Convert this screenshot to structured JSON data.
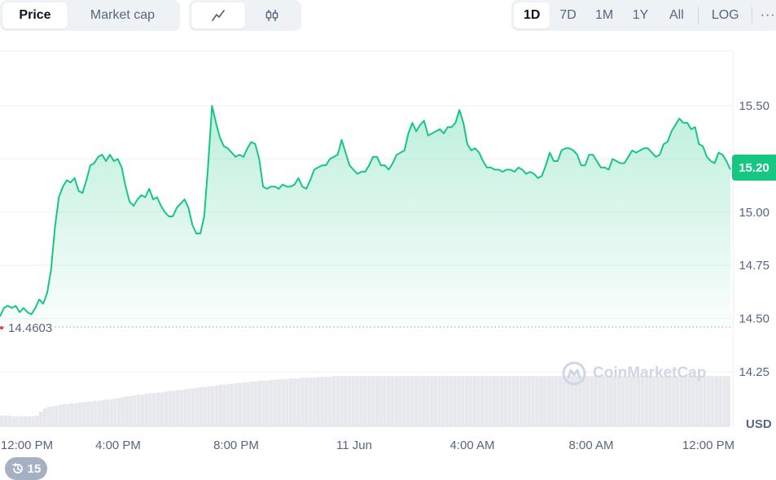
{
  "toolbar": {
    "type_options": [
      "Price",
      "Market cap"
    ],
    "type_selected": "Price",
    "mode_icons": [
      "line-chart-icon",
      "candlestick-icon"
    ],
    "range_options": [
      "1D",
      "7D",
      "1M",
      "1Y",
      "All"
    ],
    "range_selected": "1D",
    "log_label": "LOG",
    "more_label": "···"
  },
  "badges": {
    "current_price": "15.20",
    "open_price": "14.4603",
    "currency": "USD",
    "watermark": "CoinMarketCap",
    "history_count": "15"
  },
  "colors": {
    "line": "#16c784",
    "badge": "#16c784",
    "volume": "#e6e8ec",
    "grid": "#eff2f5",
    "text_muted": "#58667e"
  },
  "chart_data": {
    "type": "area",
    "y_ticks": [
      "15.50",
      "15.00",
      "14.75",
      "14.50",
      "14.25"
    ],
    "x_ticks": [
      "12:00 PM",
      "4:00 PM",
      "8:00 PM",
      "11 Jun",
      "4:00 AM",
      "8:00 AM",
      "12:00 PM"
    ],
    "ylim": [
      14.25,
      15.75
    ],
    "baseline": 14.4603,
    "series": [
      {
        "values": [
          14.51,
          14.55,
          14.56,
          14.55,
          14.56,
          14.53,
          14.55,
          14.53,
          14.52,
          14.55,
          14.59,
          14.57,
          14.62,
          14.73,
          14.93,
          15.07,
          15.12,
          15.15,
          15.14,
          15.16,
          15.1,
          15.09,
          15.15,
          15.22,
          15.23,
          15.26,
          15.27,
          15.24,
          15.27,
          15.24,
          15.25,
          15.21,
          15.12,
          15.05,
          15.03,
          15.06,
          15.08,
          15.07,
          15.11,
          15.06,
          15.07,
          15.03,
          15.0,
          14.98,
          14.98,
          15.02,
          15.04,
          15.06,
          15.02,
          14.94,
          14.9,
          14.9,
          14.98,
          15.22,
          15.5,
          15.42,
          15.35,
          15.31,
          15.3,
          15.28,
          15.26,
          15.27,
          15.26,
          15.3,
          15.33,
          15.32,
          15.25,
          15.12,
          15.11,
          15.12,
          15.12,
          15.11,
          15.13,
          15.12,
          15.12,
          15.13,
          15.16,
          15.12,
          15.11,
          15.15,
          15.2,
          15.21,
          15.22,
          15.22,
          15.25,
          15.26,
          15.27,
          15.34,
          15.28,
          15.22,
          15.2,
          15.18,
          15.19,
          15.19,
          15.22,
          15.26,
          15.26,
          15.22,
          15.22,
          15.2,
          15.23,
          15.27,
          15.28,
          15.29,
          15.37,
          15.42,
          15.38,
          15.41,
          15.43,
          15.36,
          15.37,
          15.38,
          15.39,
          15.37,
          15.4,
          15.4,
          15.42,
          15.48,
          15.42,
          15.32,
          15.29,
          15.3,
          15.28,
          15.24,
          15.21,
          15.21,
          15.2,
          15.2,
          15.19,
          15.2,
          15.2,
          15.19,
          15.21,
          15.2,
          15.18,
          15.19,
          15.18,
          15.16,
          15.17,
          15.22,
          15.28,
          15.24,
          15.24,
          15.29,
          15.3,
          15.3,
          15.29,
          15.27,
          15.22,
          15.22,
          15.27,
          15.27,
          15.24,
          15.21,
          15.21,
          15.2,
          15.25,
          15.24,
          15.23,
          15.23,
          15.26,
          15.29,
          15.28,
          15.29,
          15.3,
          15.3,
          15.28,
          15.26,
          15.27,
          15.32,
          15.33,
          15.38,
          15.41,
          15.44,
          15.42,
          15.42,
          15.39,
          15.4,
          15.32,
          15.31,
          15.26,
          15.24,
          15.23,
          15.28,
          15.27,
          15.24,
          15.2
        ]
      }
    ],
    "volume": [
      0.15,
      0.15,
      0.15,
      0.14,
      0.14,
      0.14,
      0.14,
      0.14,
      0.14,
      0.15,
      0.2,
      0.24,
      0.26,
      0.27,
      0.28,
      0.29,
      0.3,
      0.3,
      0.31,
      0.31,
      0.32,
      0.32,
      0.33,
      0.33,
      0.34,
      0.34,
      0.35,
      0.36,
      0.36,
      0.37,
      0.38,
      0.39,
      0.4,
      0.4,
      0.41,
      0.42,
      0.42,
      0.43,
      0.44,
      0.44,
      0.45,
      0.45,
      0.46,
      0.47,
      0.47,
      0.48,
      0.48,
      0.49,
      0.5,
      0.5,
      0.51,
      0.52,
      0.52,
      0.53,
      0.53,
      0.54,
      0.55,
      0.55,
      0.56,
      0.56,
      0.57,
      0.57,
      0.58,
      0.58,
      0.59,
      0.59,
      0.6,
      0.6,
      0.6,
      0.61,
      0.61,
      0.62,
      0.62,
      0.62,
      0.63,
      0.63,
      0.63,
      0.64,
      0.64,
      0.64,
      0.64,
      0.65,
      0.65,
      0.65,
      0.65,
      0.66,
      0.66,
      0.66,
      0.66,
      0.66,
      0.66,
      0.66,
      0.66,
      0.66,
      0.66,
      0.66,
      0.66,
      0.66,
      0.66,
      0.66,
      0.66,
      0.66,
      0.66,
      0.66,
      0.66,
      0.66,
      0.66,
      0.66,
      0.66,
      0.66,
      0.66,
      0.66,
      0.66,
      0.66,
      0.66,
      0.66,
      0.66,
      0.66,
      0.66,
      0.66,
      0.66,
      0.66,
      0.66,
      0.66,
      0.66,
      0.66,
      0.66,
      0.66,
      0.66,
      0.66,
      0.66,
      0.66,
      0.66,
      0.66,
      0.66,
      0.66,
      0.66,
      0.66,
      0.66,
      0.66,
      0.66,
      0.66,
      0.66,
      0.66,
      0.66,
      0.66,
      0.66,
      0.66,
      0.66,
      0.66,
      0.66,
      0.66,
      0.66,
      0.66,
      0.66,
      0.66,
      0.66,
      0.66,
      0.66,
      0.66,
      0.66,
      0.66,
      0.66,
      0.66,
      0.66,
      0.66,
      0.66,
      0.66,
      0.66,
      0.66,
      0.66,
      0.66,
      0.66,
      0.66,
      0.66,
      0.66,
      0.66,
      0.66,
      0.66,
      0.66,
      0.66,
      0.66,
      0.66,
      0.66,
      0.66,
      0.66,
      0.66
    ],
    "grid": true
  }
}
